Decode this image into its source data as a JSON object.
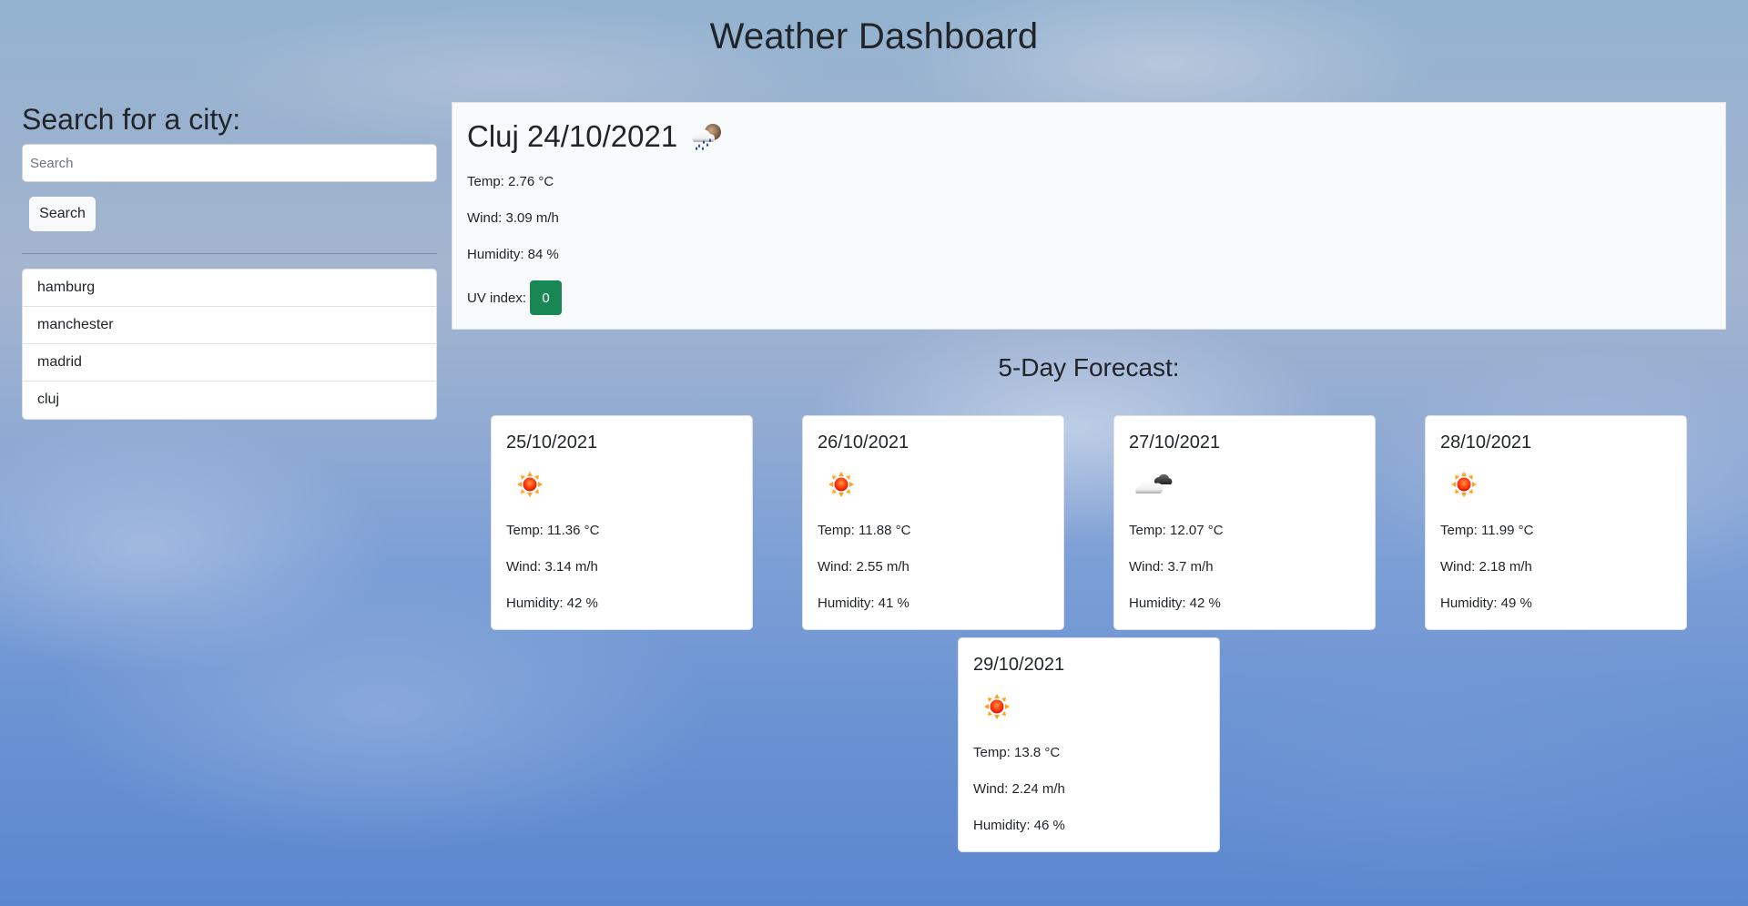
{
  "header": {
    "title": "Weather Dashboard"
  },
  "search": {
    "heading": "Search for a city:",
    "placeholder": "Search",
    "value": "",
    "button_label": "Search"
  },
  "history": {
    "items": [
      {
        "label": "hamburg"
      },
      {
        "label": "manchester"
      },
      {
        "label": "madrid"
      },
      {
        "label": "cluj"
      }
    ]
  },
  "current": {
    "title": "Cluj 24/10/2021",
    "icon": "rain-cloud-icon",
    "temp": "Temp: 2.76 °C",
    "wind": "Wind: 3.09 m/h",
    "humidity": "Humidity: 84 %",
    "uv_label": "UV index:",
    "uv_value": "0",
    "uv_color": "#198754"
  },
  "forecast": {
    "heading": "5-Day Forecast:",
    "days": [
      {
        "date": "25/10/2021",
        "icon": "sun-icon",
        "temp": "Temp: 11.36 °C",
        "wind": "Wind: 3.14 m/h",
        "humidity": "Humidity: 42 %"
      },
      {
        "date": "26/10/2021",
        "icon": "sun-icon",
        "temp": "Temp: 11.88 °C",
        "wind": "Wind: 2.55 m/h",
        "humidity": "Humidity: 41 %"
      },
      {
        "date": "27/10/2021",
        "icon": "clouds-icon",
        "temp": "Temp: 12.07 °C",
        "wind": "Wind: 3.7 m/h",
        "humidity": "Humidity: 42 %"
      },
      {
        "date": "28/10/2021",
        "icon": "sun-icon",
        "temp": "Temp: 11.99 °C",
        "wind": "Wind: 2.18 m/h",
        "humidity": "Humidity: 49 %"
      },
      {
        "date": "29/10/2021",
        "icon": "sun-icon",
        "temp": "Temp: 13.8 °C",
        "wind": "Wind: 2.24 m/h",
        "humidity": "Humidity: 46 %"
      }
    ]
  }
}
